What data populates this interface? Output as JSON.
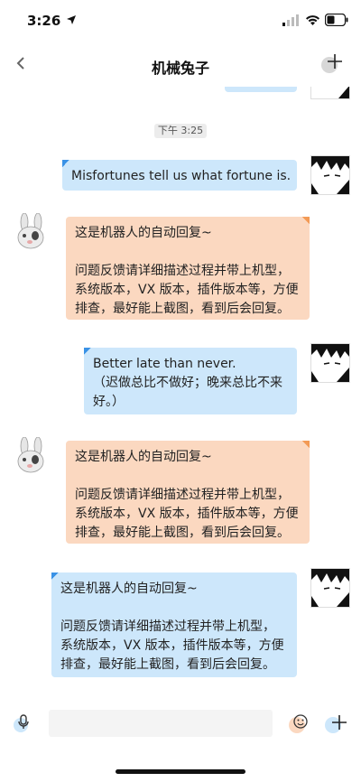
{
  "status": {
    "time": "3:26"
  },
  "header": {
    "title": "机械兔子"
  },
  "chat": {
    "timestamp": "下午 3:25",
    "messages": [
      {
        "from": "user",
        "lines": [
          "Misfortunes tell us what fortune is."
        ]
      },
      {
        "from": "bot",
        "lines": [
          "这是机器人的自动回复~",
          "",
          "问题反馈请详细描述过程并带上机型，",
          "系统版本，VX 版本，插件版本等，方便",
          "排查，最好能上截图，看到后会回复。"
        ]
      },
      {
        "from": "user",
        "lines": [
          "Better late than never.",
          "（迟做总比不做好；晚来总比不来",
          "好。）"
        ]
      },
      {
        "from": "bot",
        "lines": [
          "这是机器人的自动回复~",
          "",
          "问题反馈请详细描述过程并带上机型，",
          "系统版本，VX 版本，插件版本等，方便",
          "排查，最好能上截图，看到后会回复。"
        ]
      },
      {
        "from": "user",
        "lines": [
          "这是机器人的自动回复~",
          "",
          "问题反馈请详细描述过程并带上机型，",
          "系统版本，VX 版本，插件版本等，方便",
          "排查，最好能上截图，看到后会回复。"
        ]
      }
    ]
  },
  "input": {
    "placeholder": ""
  },
  "icons": {
    "back": "chevron-left-icon",
    "more": "plus-icon",
    "voice": "microphone-icon",
    "emoji": "smiley-icon",
    "add": "plus-icon"
  },
  "colors": {
    "user_bubble": "#cde7fb",
    "bot_bubble": "#fbd8c0",
    "user_accent": "#3a92e6",
    "bot_accent": "#f39a55"
  }
}
